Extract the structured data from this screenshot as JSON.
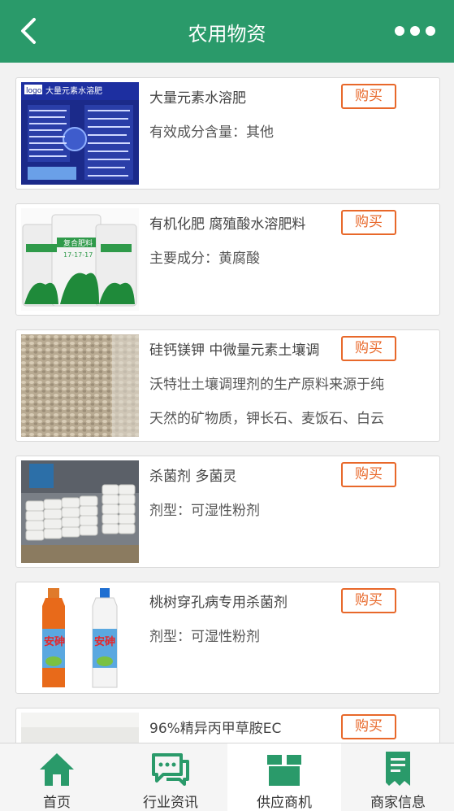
{
  "header": {
    "title": "农用物资",
    "back_icon": "chevron-left-icon",
    "more_icon": "more-dots-icon",
    "color": "#2a9a6a"
  },
  "products": [
    {
      "name": "大量元素水溶肥",
      "lines": [
        "有效成分含量：其他"
      ],
      "buy_label": "购买",
      "thumb_text": [
        "logo",
        "大量元素水溶肥"
      ]
    },
    {
      "name": "有机化肥 腐殖酸水溶肥料",
      "lines": [
        "主要成分：黄腐酸"
      ],
      "buy_label": "购买",
      "thumb_text": [
        "复合肥料",
        "17-17-17"
      ]
    },
    {
      "name": "硅钙镁钾 中微量元素土壤调",
      "lines": [
        "沃特壮土壤调理剂的生产原料来源于纯",
        "天然的矿物质，钾长石、麦饭石、白云"
      ],
      "buy_label": "购买"
    },
    {
      "name": "杀菌剂 多菌灵",
      "lines": [
        "剂型：可湿性粉剂"
      ],
      "buy_label": "购买"
    },
    {
      "name": "桃树穿孔病专用杀菌剂",
      "lines": [
        "剂型：可湿性粉剂"
      ],
      "buy_label": "购买",
      "thumb_text": [
        "安砷",
        "安砷"
      ]
    },
    {
      "name": "96%精异丙甲草胺EC",
      "lines": [],
      "buy_label": "购买"
    }
  ],
  "tabbar": {
    "items": [
      {
        "label": "首页",
        "icon": "home-icon",
        "active": false
      },
      {
        "label": "行业资讯",
        "icon": "chat-bubble-icon",
        "active": false
      },
      {
        "label": "供应商机",
        "icon": "box-icon",
        "active": true
      },
      {
        "label": "商家信息",
        "icon": "document-icon",
        "active": false
      }
    ],
    "accent": "#2a9a6a"
  },
  "colors": {
    "buy_button": "#e8682a"
  }
}
